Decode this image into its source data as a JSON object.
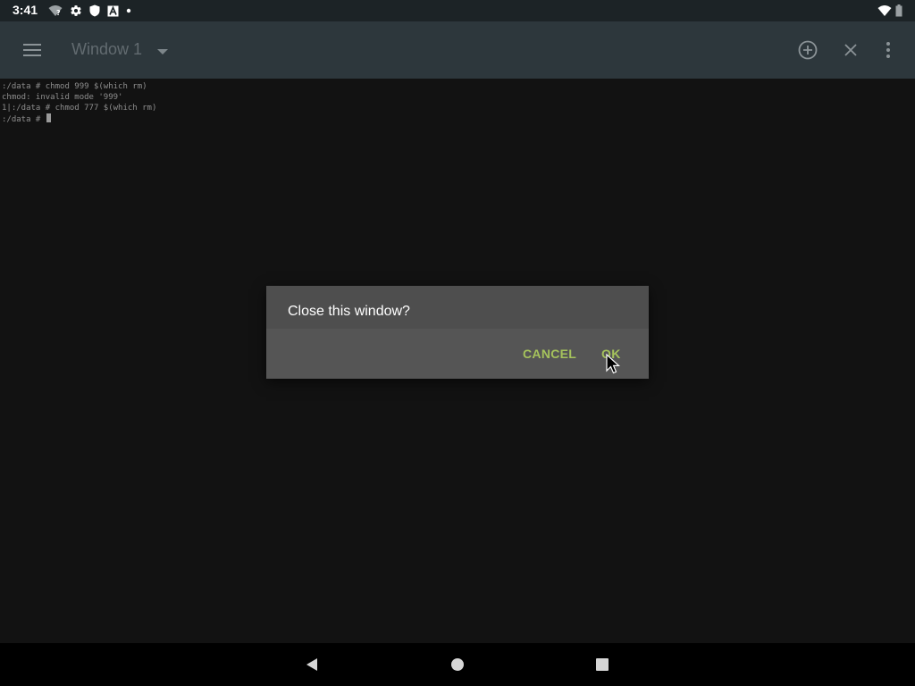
{
  "status_bar": {
    "time": "3:41",
    "left_icons": [
      "wifi-question-icon",
      "gear-icon",
      "shield-icon",
      "a-box-icon",
      "dot-icon"
    ],
    "right_icons": [
      "wifi-icon",
      "battery-icon"
    ]
  },
  "toolbar": {
    "title": "Window 1",
    "icons": [
      "menu-icon",
      "chevron-down-icon",
      "add-circle-icon",
      "close-icon",
      "more-vert-icon"
    ]
  },
  "terminal": {
    "lines": [
      ":/data # chmod 999 $(which rm)",
      "chmod: invalid mode '999'",
      "1|:/data # chmod 777 $(which rm)",
      ":/data # "
    ]
  },
  "dialog": {
    "title": "Close this window?",
    "cancel_label": "CANCEL",
    "ok_label": "OK"
  },
  "colors": {
    "accent": "#a5c25c",
    "toolbar_bg": "#2d373c",
    "terminal_bg": "#121212",
    "dialog_bg": "#555555"
  },
  "nav_bar": {
    "icons": [
      "back-icon",
      "home-icon",
      "recents-icon"
    ]
  }
}
